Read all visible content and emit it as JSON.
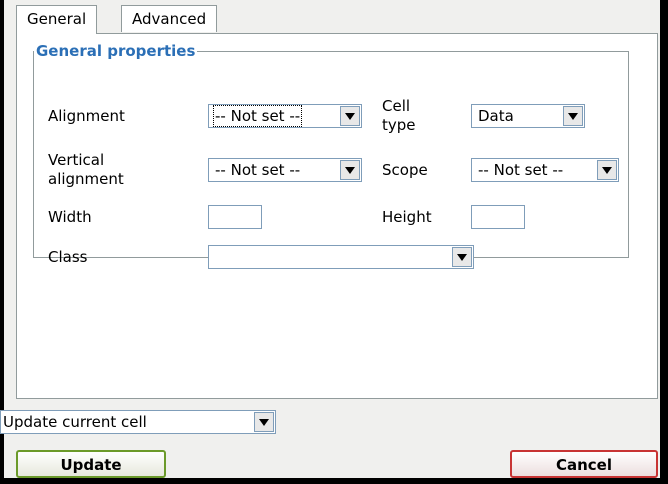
{
  "tabs": [
    {
      "label": "General",
      "active": true
    },
    {
      "label": "Advanced",
      "active": false
    }
  ],
  "general_properties": {
    "legend": "General properties",
    "alignment": {
      "label": "Alignment",
      "value": "-- Not set --"
    },
    "cell_type": {
      "label_line1": "Cell",
      "label_line2": "type",
      "value": "Data"
    },
    "vertical_alignment": {
      "label_line1": "Vertical",
      "label_line2": "alignment",
      "value": "-- Not set --"
    },
    "scope": {
      "label": "Scope",
      "value": "-- Not set --"
    },
    "width": {
      "label": "Width",
      "value": ""
    },
    "height": {
      "label": "Height",
      "value": ""
    },
    "class": {
      "label": "Class",
      "value": ""
    }
  },
  "footer": {
    "action_select": {
      "value": "Update current cell"
    },
    "update_label": "Update",
    "cancel_label": "Cancel"
  },
  "colors": {
    "legend": "#2b6fb6",
    "update_border": "#6b9a2a",
    "cancel_border": "#c83434",
    "input_border": "#7f9db9"
  }
}
